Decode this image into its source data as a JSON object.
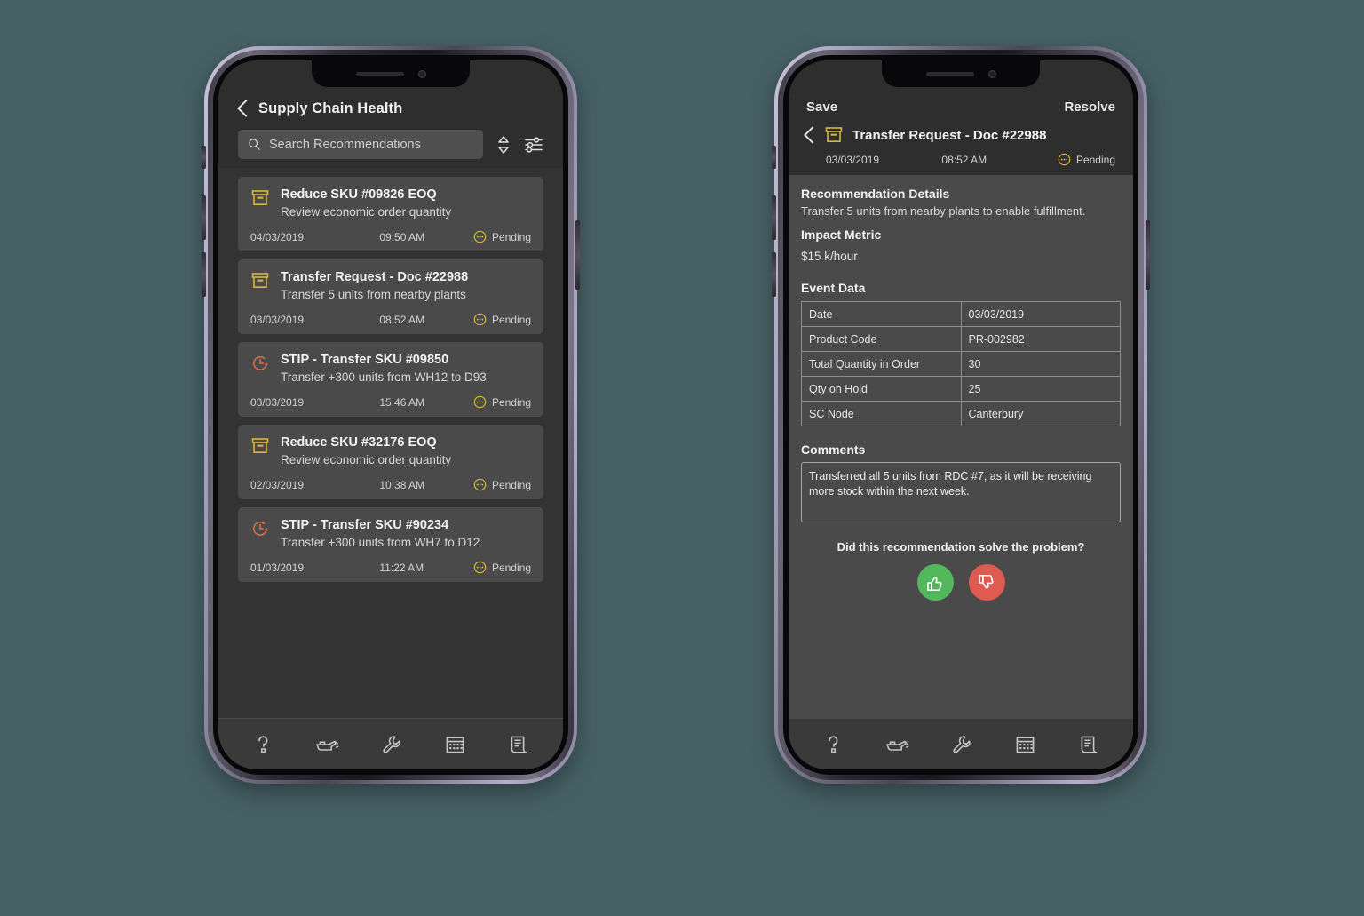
{
  "colors": {
    "background": "#466166",
    "screen_dark": "#333333",
    "header": "#2e2e2e",
    "card": "#4a4a4a",
    "accent_yellow": "#d8b642",
    "accent_orange": "#d1714a",
    "thumbs_up_green": "#52b85b",
    "thumbs_down_red": "#df5b52"
  },
  "list_screen": {
    "page_title": "Supply Chain Health",
    "back_icon": "chevron-left-icon",
    "search": {
      "placeholder": "Search Recommendations",
      "icon": "search-icon"
    },
    "sort_icon": "sort-updown-icon",
    "filter_icon": "filter-sliders-icon",
    "items": [
      {
        "icon": "archive-box-icon",
        "icon_kind": "box",
        "title": "Reduce SKU #09826 EOQ",
        "subtitle": "Review economic order quantity",
        "date": "04/03/2019",
        "time": "09:50 AM",
        "status": "Pending"
      },
      {
        "icon": "archive-box-icon",
        "icon_kind": "box",
        "title": "Transfer Request - Doc #22988",
        "subtitle": "Transfer 5 units from nearby plants",
        "date": "03/03/2019",
        "time": "08:52 AM",
        "status": "Pending"
      },
      {
        "icon": "clock-history-icon",
        "icon_kind": "clock",
        "title": "STIP - Transfer SKU #09850",
        "subtitle": "Transfer +300 units from WH12 to D93",
        "date": "03/03/2019",
        "time": "15:46 AM",
        "status": "Pending"
      },
      {
        "icon": "archive-box-icon",
        "icon_kind": "box",
        "title": "Reduce SKU #32176 EOQ",
        "subtitle": "Review economic order quantity",
        "date": "02/03/2019",
        "time": "10:38 AM",
        "status": "Pending"
      },
      {
        "icon": "clock-history-icon",
        "icon_kind": "clock",
        "title": "STIP - Transfer SKU #90234",
        "subtitle": "Transfer +300 units from WH7 to D12",
        "date": "01/03/2019",
        "time": "11:22 AM",
        "status": "Pending"
      }
    ]
  },
  "detail_screen": {
    "save_label": "Save",
    "resolve_label": "Resolve",
    "back_icon": "chevron-left-icon",
    "doc_icon": "archive-box-icon",
    "title": "Transfer Request - Doc #22988",
    "date": "03/03/2019",
    "time": "08:52 AM",
    "status": "Pending",
    "recommendation_heading": "Recommendation Details",
    "recommendation_text": "Transfer 5 units from nearby plants to enable fulfillment.",
    "impact_heading": "Impact Metric",
    "impact_value": "$15 k/hour",
    "event_heading": "Event Data",
    "event_rows": [
      {
        "key": "Date",
        "value": "03/03/2019"
      },
      {
        "key": "Product Code",
        "value": "PR-002982"
      },
      {
        "key": "Total Quantity in Order",
        "value": "30"
      },
      {
        "key": "Qty on Hold",
        "value": "25"
      },
      {
        "key": "SC Node",
        "value": "Canterbury"
      }
    ],
    "comments_heading": "Comments",
    "comments_value": "Transferred all 5 units from RDC #7, as it will be receiving more stock within the next week.",
    "feedback_question": "Did this recommendation solve the problem?",
    "thumbs_up_icon": "thumbs-up-icon",
    "thumbs_down_icon": "thumbs-down-icon"
  },
  "tabbar": {
    "tabs": [
      {
        "icon": "question-mark-icon",
        "kind": "question"
      },
      {
        "icon": "oil-can-icon",
        "kind": "oilcan"
      },
      {
        "icon": "wrench-icon",
        "kind": "wrench"
      },
      {
        "icon": "calendar-icon",
        "kind": "calendar"
      },
      {
        "icon": "document-receipt-icon",
        "kind": "document"
      }
    ]
  }
}
